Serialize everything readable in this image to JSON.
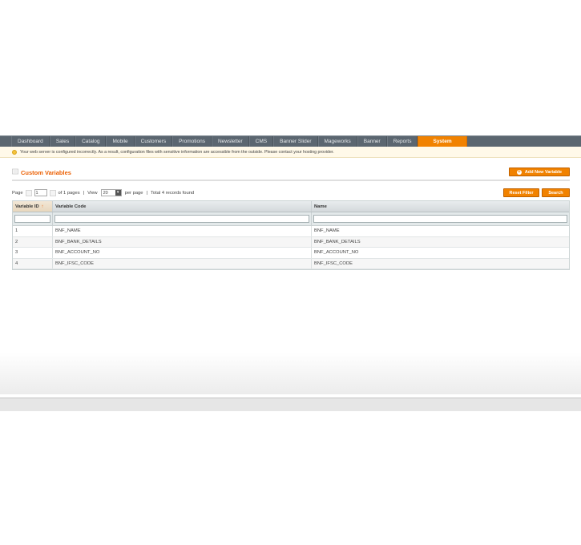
{
  "nav": {
    "items": [
      "Dashboard",
      "Sales",
      "Catalog",
      "Mobile",
      "Customers",
      "Promotions",
      "Newsletter",
      "CMS",
      "Banner Slider",
      "Mageworks",
      "Banner",
      "Reports",
      "System"
    ],
    "active": "System"
  },
  "notice": {
    "text": "Your web server is configured incorrectly. As a result, configuration files with sensitive information are accessible from the outside. Please contact your hosting provider."
  },
  "page": {
    "title": "Custom Variables",
    "add_button": "Add New Variable"
  },
  "pager": {
    "page_label": "Page",
    "page_value": "1",
    "of_pages": "of 1 pages",
    "view_label": "View",
    "per_page_value": "20",
    "per_page_label": "per page",
    "total": "Total 4 records found",
    "reset_button": "Reset Filter",
    "search_button": "Search"
  },
  "grid": {
    "columns": [
      "Variable ID",
      "Variable Code",
      "Name"
    ],
    "sorted_column": "Variable ID",
    "rows": [
      [
        "1",
        "BNF_NAME",
        "BNF_NAME"
      ],
      [
        "2",
        "BNF_BANK_DETAILS",
        "BNF_BANK_DETAILS"
      ],
      [
        "3",
        "BNF_ACCOUNT_NO",
        "BNF_ACCOUNT_NO"
      ],
      [
        "4",
        "BNF_IFSC_CODE",
        "BNF_IFSC_CODE"
      ]
    ]
  },
  "colors": {
    "accent": "#f18200",
    "title": "#eb5e00",
    "nav_bg": "#5b6670",
    "notice_bg": "#fff9e9"
  },
  "icons": {
    "notice": "lightbulb-icon",
    "title": "variables-icon",
    "add": "plus-circle-icon",
    "sort": "sort-arrow-icon",
    "dropdown": "chevron-down-icon"
  }
}
